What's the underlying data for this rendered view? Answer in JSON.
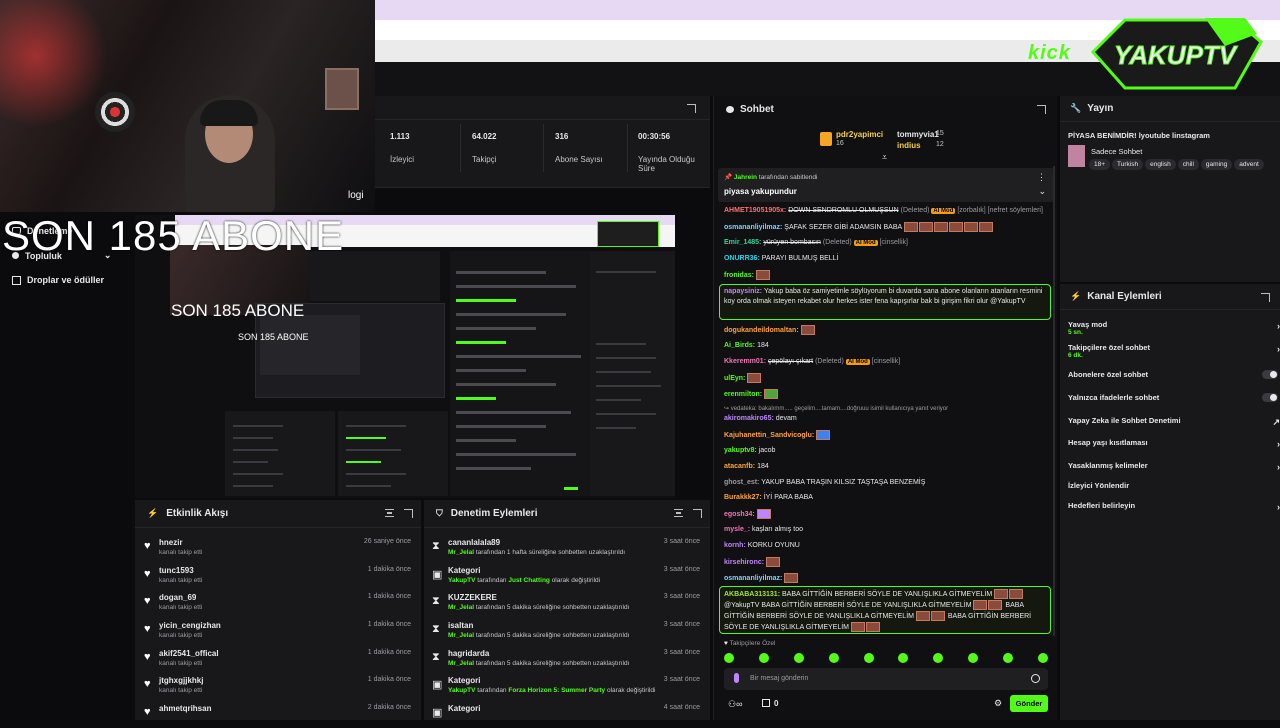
{
  "overlay": {
    "abone_text": "SON 185 ABONE"
  },
  "webcam": {
    "caption": "logi"
  },
  "brand": {
    "kick": "kick",
    "channel_logo": "YAKUPTV"
  },
  "sidebar": {
    "items": [
      {
        "label": "Denetleme"
      },
      {
        "label": "Topluluk"
      },
      {
        "label": "Droplar ve ödüller"
      }
    ]
  },
  "stats": [
    {
      "value": "1.113",
      "label": "İzleyici"
    },
    {
      "value": "64.022",
      "label": "Takipçi"
    },
    {
      "value": "316",
      "label": "Abone Sayısı"
    },
    {
      "value": "00:30:56",
      "label": "Yayında Olduğu Süre"
    }
  ],
  "nested_preview": {
    "abone_big": "SON 185 ABONE",
    "abone_small": "SON 185 ABONE"
  },
  "activity": {
    "title": "Etkinlik Akışı",
    "rows": [
      {
        "name": "hnezir",
        "sub": "kanalı takip etti",
        "time": "26 saniye önce"
      },
      {
        "name": "tunc1593",
        "sub": "kanalı takip etti",
        "time": "1 dakika önce"
      },
      {
        "name": "dogan_69",
        "sub": "kanalı takip etti",
        "time": "1 dakika önce"
      },
      {
        "name": "yicin_cengizhan",
        "sub": "kanalı takip etti",
        "time": "1 dakika önce"
      },
      {
        "name": "akif2541_offical",
        "sub": "kanalı takip etti",
        "time": "1 dakika önce"
      },
      {
        "name": "jtghxgjjkhkj",
        "sub": "kanalı takip etti",
        "time": "1 dakika önce"
      },
      {
        "name": "ahmetqrihsan",
        "sub": "",
        "time": "2 dakika önce"
      }
    ]
  },
  "moderation": {
    "title": "Denetim Eylemleri",
    "rows": [
      {
        "icon": "hourglass",
        "name": "cananlalala89",
        "user": "Mr_Jelal",
        "text": " tarafından 1 hafta süreliğine sohbetten uzaklaştırıldı",
        "time": "3 saat önce",
        "extra": "",
        "tail": ""
      },
      {
        "icon": "category",
        "name": "Kategori",
        "user": "YakupTV",
        "text": " tarafından ",
        "extra": "Just Chatting",
        "tail": " olarak değiştirildi",
        "time": "3 saat önce"
      },
      {
        "icon": "hourglass",
        "name": "KUZZEKERE",
        "user": "Mr_Jelal",
        "text": " tarafından 5 dakika süreliğine sohbetten uzaklaştırıldı",
        "time": "3 saat önce",
        "extra": "",
        "tail": ""
      },
      {
        "icon": "hourglass",
        "name": "isaltan",
        "user": "Mr_Jelal",
        "text": " tarafından 5 dakika süreliğine sohbetten uzaklaştırıldı",
        "time": "3 saat önce",
        "extra": "",
        "tail": ""
      },
      {
        "icon": "hourglass",
        "name": "hagridarda",
        "user": "Mr_Jelal",
        "text": " tarafından 5 dakika süreliğine sohbetten uzaklaştırıldı",
        "time": "3 saat önce",
        "extra": "",
        "tail": ""
      },
      {
        "icon": "category",
        "name": "Kategori",
        "user": "YakupTV",
        "text": " tarafından ",
        "extra": "Forza Horizon 5: Summer Party",
        "tail": " olarak değiştirildi",
        "time": "3 saat önce"
      },
      {
        "icon": "category",
        "name": "Kategori",
        "user": "",
        "text": "",
        "extra": "",
        "tail": "",
        "time": "4 saat önce"
      }
    ]
  },
  "chat": {
    "title": "Sohbet",
    "leaders": [
      {
        "name": "pdr2yapimci",
        "count": "16"
      },
      {
        "name": "tommyvia1",
        "count": "15"
      },
      {
        "name": "indius",
        "count": "12"
      }
    ],
    "pinned": {
      "by": "Jahrein",
      "by_suffix": " tarafından sabitlendi",
      "text": "piyasa yakupundur"
    },
    "input_placeholder": "Bir mesaj gönderin",
    "followers_only": "Takipçilere Özel",
    "send": "Gönder",
    "points": "0"
  },
  "stream_info": {
    "title_label": "Yayın",
    "stream_title": "PİYASA BENİMDİR! lyoutube linstagram",
    "category": "Sadece Sohbet",
    "tags": [
      "18+",
      "Turkish",
      "english",
      "chill",
      "gaming",
      "advent"
    ]
  },
  "channel_actions": {
    "title": "Kanal Eylemleri",
    "items": [
      {
        "label": "Yavaş mod",
        "sub": "5 sn.",
        "kind": "chevron"
      },
      {
        "label": "Takipçilere özel sohbet",
        "sub": "6 dk.",
        "kind": "chevron"
      },
      {
        "label": "Abonelere özel sohbet",
        "sub": "",
        "kind": "toggle"
      },
      {
        "label": "Yalnızca ifadelerle sohbet",
        "sub": "",
        "kind": "toggle"
      },
      {
        "label": "Yapay Zeka ile Sohbet Denetimi",
        "sub": "",
        "kind": "external"
      },
      {
        "label": "Hesap yaşı kısıtlaması",
        "sub": "",
        "kind": "chevron"
      },
      {
        "label": "Yasaklanmış kelimeler",
        "sub": "",
        "kind": "chevron"
      },
      {
        "label": "İzleyici Yönlendir",
        "sub": "",
        "kind": "none"
      },
      {
        "label": "Hedefleri belirleyin",
        "sub": "",
        "kind": "chevron"
      }
    ]
  }
}
